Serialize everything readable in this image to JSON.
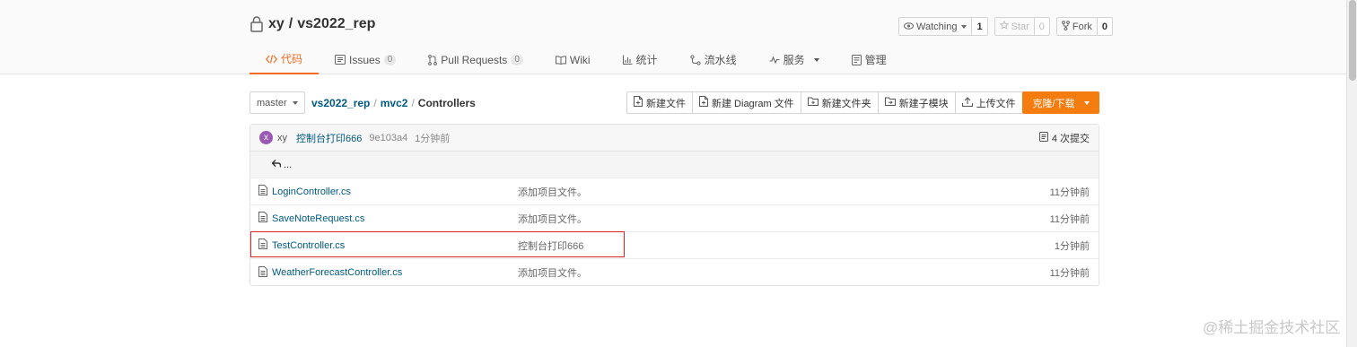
{
  "repo": {
    "owner": "xy",
    "separator": "/",
    "name": "vs2022_rep"
  },
  "actions": {
    "watch": {
      "label": "Watching",
      "count": "1"
    },
    "star": {
      "label": "Star",
      "count": "0"
    },
    "fork": {
      "label": "Fork",
      "count": "0"
    }
  },
  "tabs": [
    {
      "label": "代码",
      "icon": "code-icon",
      "active": true
    },
    {
      "label": "Issues",
      "badge": "0",
      "icon": "issues-icon"
    },
    {
      "label": "Pull Requests",
      "badge": "0",
      "icon": "pull-request-icon"
    },
    {
      "label": "Wiki",
      "icon": "wiki-icon"
    },
    {
      "label": "统计",
      "icon": "stats-icon"
    },
    {
      "label": "流水线",
      "icon": "pipeline-icon"
    },
    {
      "label": "服务",
      "icon": "service-icon"
    },
    {
      "label": "管理",
      "icon": "manage-icon"
    }
  ],
  "toolbar": {
    "branch": "master",
    "breadcrumb": [
      {
        "label": "vs2022_rep"
      },
      {
        "label": "mvc2"
      },
      {
        "label": "Controllers"
      }
    ],
    "breadcrumb_sep": "/",
    "file_actions": [
      {
        "label": "新建文件"
      },
      {
        "label": "新建 Diagram 文件"
      },
      {
        "label": "新建文件夹"
      },
      {
        "label": "新建子模块"
      },
      {
        "label": "上传文件"
      }
    ],
    "clone_label": "克隆/下载"
  },
  "commit": {
    "avatar_letter": "x",
    "author": "xy",
    "message": "控制台打印666",
    "sha": "9e103a4",
    "time": "1分钟前",
    "count_label": "4 次提交"
  },
  "parent_dir": "...",
  "files": [
    {
      "name": "LoginController.cs",
      "message": "添加项目文件。",
      "time": "11分钟前"
    },
    {
      "name": "SaveNoteRequest.cs",
      "message": "添加项目文件。",
      "time": "11分钟前"
    },
    {
      "name": "TestController.cs",
      "message": "控制台打印666",
      "time": "1分钟前",
      "highlighted": true
    },
    {
      "name": "WeatherForecastController.cs",
      "message": "添加项目文件。",
      "time": "11分钟前"
    }
  ],
  "colors": {
    "accent": "#f36b20",
    "clone_button": "#f57c0e",
    "link": "#005980",
    "highlight_box": "#d9252a"
  },
  "watermark": "@稀土掘金技术社区"
}
